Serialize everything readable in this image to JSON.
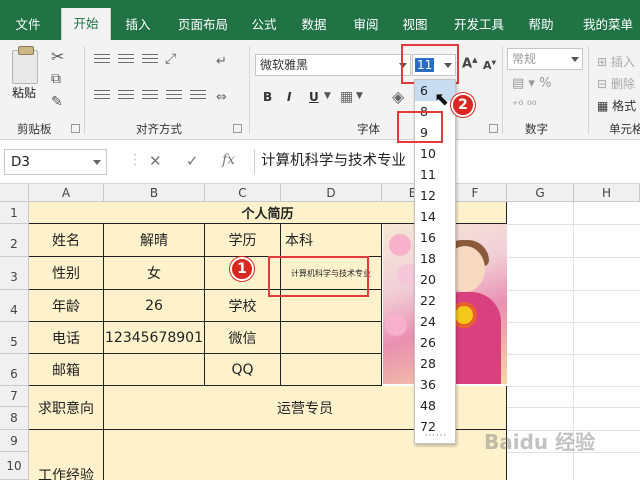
{
  "ribbon_tabs": [
    "文件",
    "开始",
    "插入",
    "页面布局",
    "公式",
    "数据",
    "审阅",
    "视图",
    "开发工具",
    "帮助",
    "我的菜单"
  ],
  "active_tab": "开始",
  "clipboard": {
    "paste_label": "粘贴",
    "group_label": "剪贴板"
  },
  "alignment": {
    "group_label": "对齐方式"
  },
  "font": {
    "name": "微软雅黑",
    "size": "11",
    "group_label": "字体",
    "bold": "B",
    "italic": "I",
    "underline": "U"
  },
  "number": {
    "format": "常规",
    "group_label": "数字"
  },
  "cells": {
    "group_label": "单元格",
    "insert": "插入",
    "delete": "删除",
    "format": "格式"
  },
  "formula_bar": {
    "name_box": "D3",
    "cancel": "✕",
    "enter": "✓",
    "fx": "fx",
    "value": "计算机科学与技术专业"
  },
  "columns": [
    "A",
    "B",
    "C",
    "D",
    "E",
    "F",
    "G",
    "H"
  ],
  "rows": [
    "1",
    "2",
    "3",
    "4",
    "5",
    "6",
    "7",
    "8",
    "9",
    "10"
  ],
  "resume": {
    "title": "个人简历",
    "name_label": "姓名",
    "name_value": "解晴",
    "education_label": "学历",
    "education_value": "本科",
    "gender_label": "性别",
    "gender_value": "女",
    "major_value": "计算机科学与技术专业",
    "age_label": "年龄",
    "age_value": "26",
    "school_label": "学校",
    "phone_label": "电话",
    "phone_value": "12345678901",
    "wechat_label": "微信",
    "email_label": "邮箱",
    "qq_label": "QQ",
    "job_intent_label": "求职意向",
    "job_intent_value": "运营专员",
    "work_exp_label": "工作经验"
  },
  "font_size_options": [
    "6",
    "8",
    "9",
    "10",
    "11",
    "12",
    "14",
    "16",
    "18",
    "20",
    "22",
    "24",
    "26",
    "28",
    "36",
    "48",
    "72"
  ],
  "highlighted_font_size": "6",
  "dropdown_grip": "⋯⋯",
  "badges": [
    "1",
    "2"
  ],
  "watermark": "Baidu 经验",
  "colors": {
    "excel_green": "#217346",
    "cell_fill": "#fef2cc",
    "callout": "#e23b3b"
  }
}
